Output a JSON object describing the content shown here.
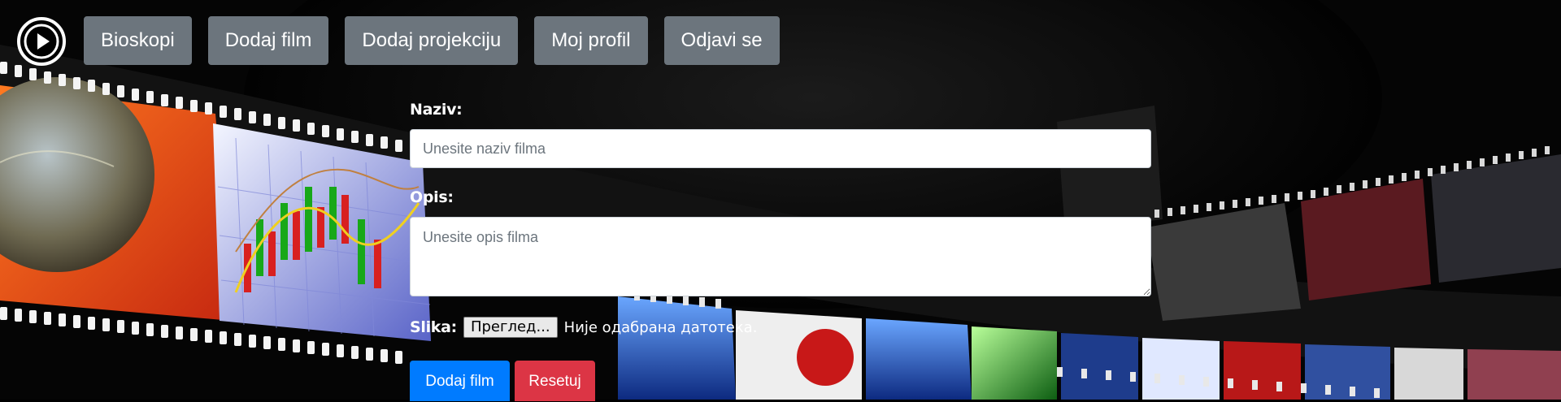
{
  "nav": {
    "items": [
      {
        "label": "Bioskopi"
      },
      {
        "label": "Dodaj film"
      },
      {
        "label": "Dodaj projekciju"
      },
      {
        "label": "Moj profil"
      },
      {
        "label": "Odjavi se"
      }
    ]
  },
  "form": {
    "naziv_label": "Naziv:",
    "naziv_placeholder": "Unesite naziv filma",
    "opis_label": "Opis:",
    "opis_placeholder": "Unesite opis filma",
    "slika_label": "Slika:",
    "file_button_label": "Преглед...",
    "file_status": "Није одабрана датотека.",
    "submit_label": "Dodaj film",
    "reset_label": "Resetuj"
  },
  "colors": {
    "nav_button": "#6c757d",
    "primary": "#007bff",
    "danger": "#dc3545"
  }
}
